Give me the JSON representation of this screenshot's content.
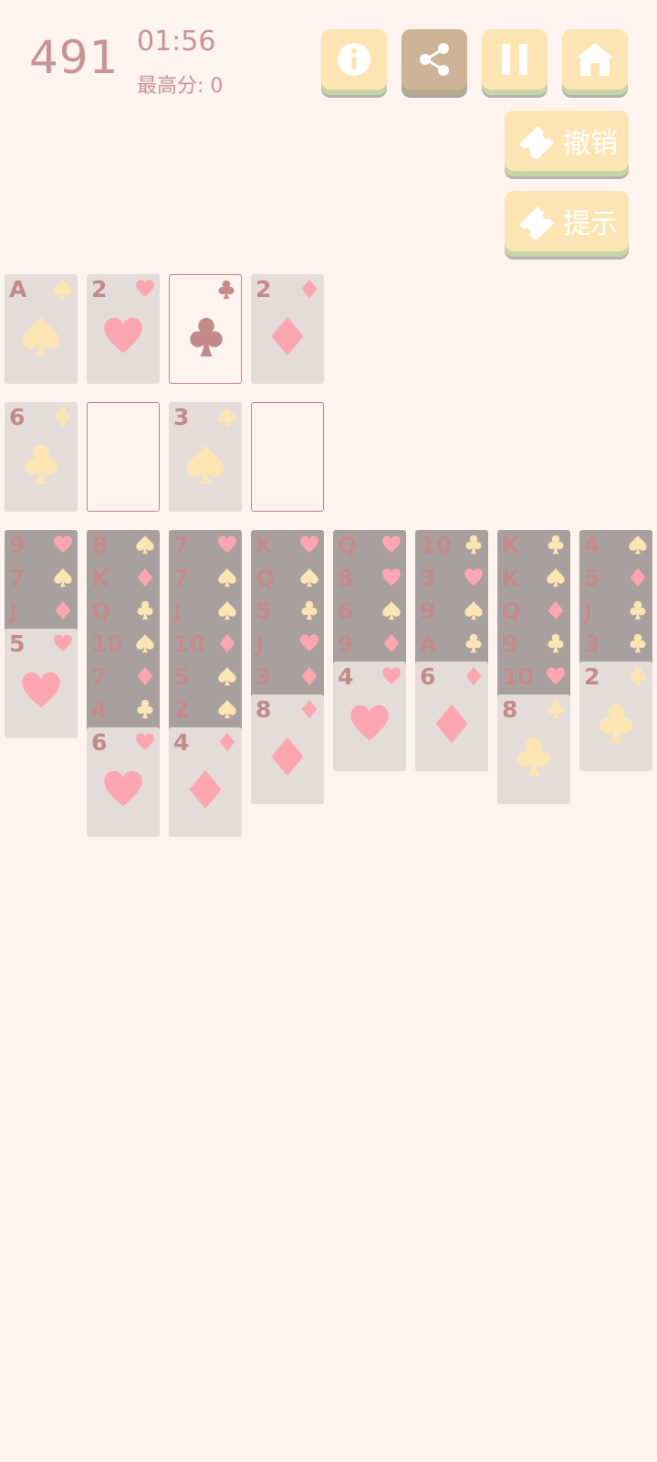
{
  "header": {
    "score": "491",
    "time": "01:56",
    "best_label": "最高分: 0"
  },
  "toolbar": {
    "undo_label": "撤销",
    "hint_label": "提示"
  },
  "colors": {
    "heart": "#fda5b0",
    "diamond": "#fda5b0",
    "club": "#fde5b3",
    "spade": "#fde5b3",
    "rank": "#c48a8a"
  },
  "foundation": [
    {
      "rank": "A",
      "suit": "spade"
    },
    {
      "rank": "2",
      "suit": "heart"
    },
    {
      "rank": "",
      "suit": "club",
      "state": "selected"
    },
    {
      "rank": "2",
      "suit": "diamond"
    }
  ],
  "freecells": [
    {
      "rank": "6",
      "suit": "club"
    },
    {
      "rank": "",
      "suit": "",
      "state": "empty"
    },
    {
      "rank": "3",
      "suit": "spade"
    },
    {
      "rank": "",
      "suit": "",
      "state": "empty"
    }
  ],
  "tableau": [
    {
      "down": [
        [
          "9",
          "heart"
        ],
        [
          "7",
          "spade"
        ],
        [
          "J",
          "diamond"
        ]
      ],
      "up": [
        "5",
        "heart"
      ]
    },
    {
      "down": [
        [
          "8",
          "spade"
        ],
        [
          "K",
          "diamond"
        ],
        [
          "Q",
          "club"
        ],
        [
          "10",
          "spade"
        ],
        [
          "7",
          "diamond"
        ],
        [
          "4",
          "club"
        ]
      ],
      "up": [
        "6",
        "heart"
      ]
    },
    {
      "down": [
        [
          "7",
          "heart"
        ],
        [
          "7",
          "spade"
        ],
        [
          "J",
          "spade"
        ],
        [
          "10",
          "diamond"
        ],
        [
          "5",
          "spade"
        ],
        [
          "2",
          "spade"
        ]
      ],
      "up": [
        "4",
        "diamond"
      ]
    },
    {
      "down": [
        [
          "K",
          "heart"
        ],
        [
          "Q",
          "spade"
        ],
        [
          "5",
          "club"
        ],
        [
          "J",
          "heart"
        ],
        [
          "3",
          "diamond"
        ]
      ],
      "up": [
        "8",
        "diamond"
      ]
    },
    {
      "down": [
        [
          "Q",
          "heart"
        ],
        [
          "8",
          "heart"
        ],
        [
          "6",
          "spade"
        ],
        [
          "9",
          "diamond"
        ]
      ],
      "up": [
        "4",
        "heart"
      ]
    },
    {
      "down": [
        [
          "10",
          "club"
        ],
        [
          "3",
          "heart"
        ],
        [
          "9",
          "spade"
        ],
        [
          "A",
          "club"
        ]
      ],
      "up": [
        "6",
        "diamond"
      ]
    },
    {
      "down": [
        [
          "K",
          "club"
        ],
        [
          "K",
          "spade"
        ],
        [
          "Q",
          "diamond"
        ],
        [
          "9",
          "club"
        ],
        [
          "10",
          "heart"
        ]
      ],
      "up": [
        "8",
        "club"
      ]
    },
    {
      "down": [
        [
          "4",
          "spade"
        ],
        [
          "5",
          "diamond"
        ],
        [
          "J",
          "club"
        ],
        [
          "3",
          "club"
        ]
      ],
      "up": [
        "2",
        "club"
      ]
    }
  ]
}
